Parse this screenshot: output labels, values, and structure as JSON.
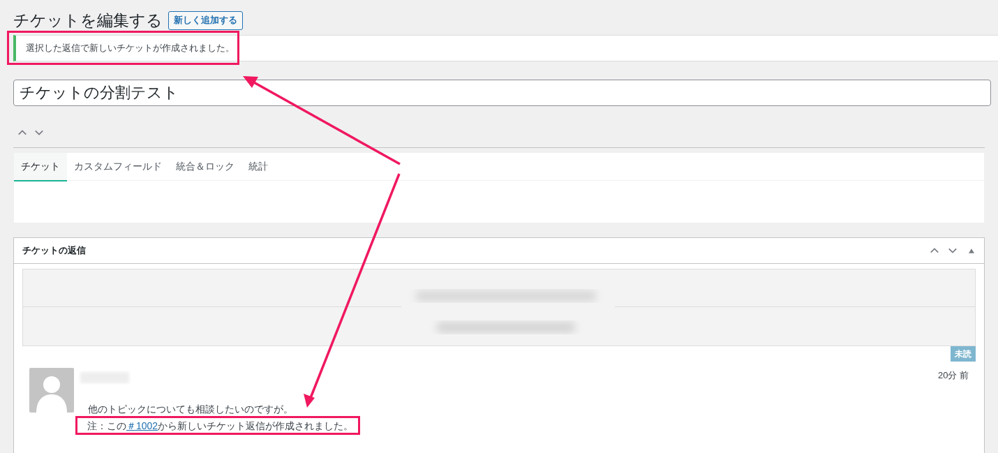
{
  "page_title": "チケットを編集する",
  "add_new_button": "新しく追加する",
  "notice": {
    "text": "選択した返信で新しいチケットが作成されました。",
    "kind": "success"
  },
  "title_field": {
    "value": "チケットの分割テスト"
  },
  "tabs": [
    {
      "label": "チケット",
      "selected": true
    },
    {
      "label": "カスタムフィールド",
      "selected": false
    },
    {
      "label": "統合＆ロック",
      "selected": false
    },
    {
      "label": "統計",
      "selected": false
    }
  ],
  "replies_panel": {
    "title": "チケットの返信",
    "reply": {
      "badge": "未読",
      "time": "20分 前",
      "message": "他のトピックについても相談したいのですが。",
      "note": {
        "prefix": "注：この",
        "link": "＃1002",
        "suffix": "から新しいチケット返信が作成されました。"
      }
    }
  }
}
